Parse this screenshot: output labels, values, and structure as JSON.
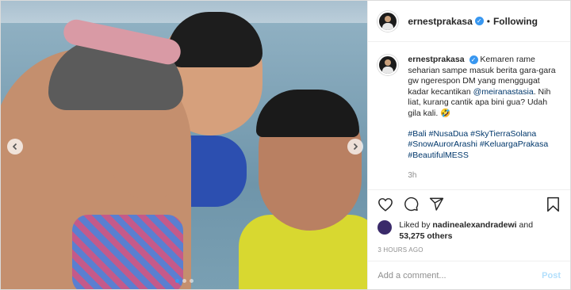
{
  "post": {
    "username": "ernestprakasa",
    "follow_separator": "•",
    "follow_label": "Following",
    "more_label": "•••",
    "verified_glyph": "✓",
    "caption_parts": {
      "text1": "Kemaren rame seharian sampe masuk berita gara-gara gw ngerespon DM yang menggugat kadar kecantikan ",
      "mention": "@meiranastasia",
      "text2": ". Nih liat, kurang cantik apa bini gua? Udah gila kali. ",
      "emoji": "🤣"
    },
    "hashtags": "#Bali #NusaDua #SkyTierraSolana #SnowAurorArashi #KeluargaPrakasa #BeautifulMESS",
    "caption_time": "3h",
    "liked_by_prefix": "Liked by",
    "liked_by_user": "nadinealexandradewi",
    "liked_by_and": "and",
    "likes_count": "53,275 others",
    "timestamp": "3 HOURS AGO",
    "comment_placeholder": "Add a comment...",
    "post_button": "Post"
  },
  "icons": {
    "like": "heart-icon",
    "comment": "comment-icon",
    "share": "share-icon",
    "save": "bookmark-icon",
    "carousel_prev": "chevron-left-icon",
    "carousel_next": "chevron-right-icon"
  },
  "carousel": {
    "total": 3,
    "active_index": 0
  },
  "colors": {
    "verified": "#3897f0",
    "link": "#00376b",
    "post_disabled": "#b2dffc",
    "muted": "#8e8e8e"
  }
}
